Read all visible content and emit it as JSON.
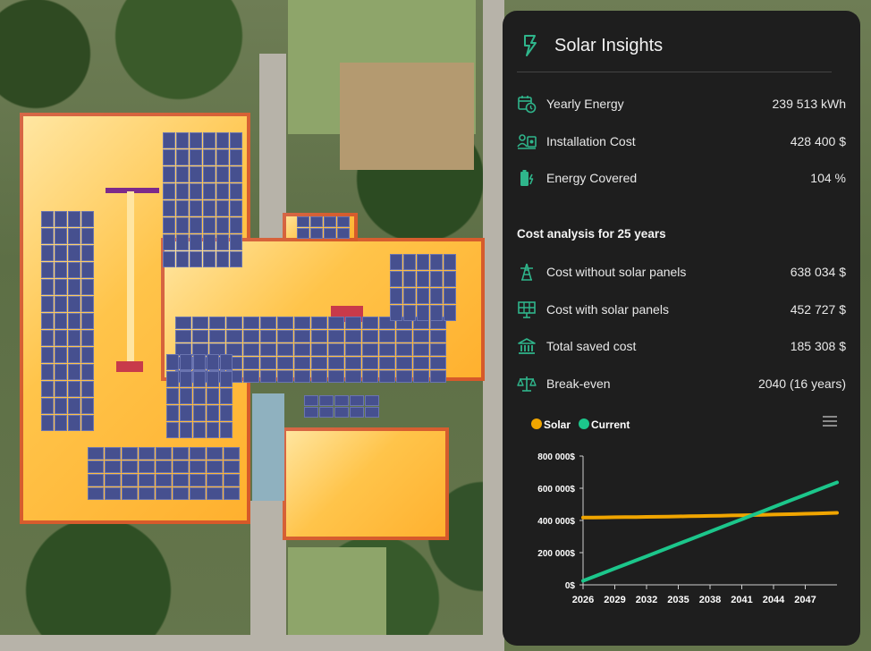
{
  "panel": {
    "title": "Solar Insights",
    "accent": "#2fb58b",
    "rows": [
      {
        "icon": "calendar-clock-icon",
        "label": "Yearly Energy",
        "value": "239 513 kWh"
      },
      {
        "icon": "installation-cost-icon",
        "label": "Installation Cost",
        "value": "428 400 $"
      },
      {
        "icon": "battery-charging-icon",
        "label": "Energy Covered",
        "value": "104 %"
      }
    ],
    "section_title": "Cost analysis for 25 years",
    "cost_rows": [
      {
        "icon": "power-tower-icon",
        "label": "Cost without solar panels",
        "value": "638 034 $"
      },
      {
        "icon": "solar-panel-icon",
        "label": "Cost with solar panels",
        "value": "452 727 $"
      },
      {
        "icon": "bank-icon",
        "label": "Total saved cost",
        "value": "185 308 $"
      },
      {
        "icon": "scale-balance-icon",
        "label": "Break-even",
        "value": "2040 (16 years)"
      }
    ]
  },
  "chart_data": {
    "type": "line",
    "x": [
      2026,
      2027,
      2028,
      2029,
      2030,
      2031,
      2032,
      2033,
      2034,
      2035,
      2036,
      2037,
      2038,
      2039,
      2040,
      2041,
      2042,
      2043,
      2044,
      2045,
      2046,
      2047,
      2048,
      2049,
      2050
    ],
    "x_ticks": [
      "2026",
      "2029",
      "2032",
      "2035",
      "2038",
      "2041",
      "2044",
      "2047"
    ],
    "y_ticks": [
      "0$",
      "200 000$",
      "400 000$",
      "600 000$",
      "800 000$"
    ],
    "ylim": [
      0,
      800000
    ],
    "series": [
      {
        "name": "Solar",
        "color": "#f0a500",
        "values": [
          418000,
          418500,
          419100,
          419800,
          420500,
          421300,
          422100,
          423000,
          424000,
          425000,
          426100,
          427200,
          428400,
          429600,
          430900,
          432200,
          433600,
          435000,
          436500,
          438100,
          439700,
          441400,
          443200,
          445000,
          447000
        ]
      },
      {
        "name": "Current",
        "color": "#1cc68b",
        "values": [
          25000,
          50000,
          75500,
          101000,
          126500,
          152000,
          177500,
          203000,
          228500,
          254000,
          279500,
          305000,
          330500,
          356000,
          381500,
          407000,
          432500,
          458000,
          483500,
          509000,
          534500,
          560000,
          585500,
          611000,
          636000
        ]
      }
    ],
    "legend": "top-left",
    "grid": false
  }
}
